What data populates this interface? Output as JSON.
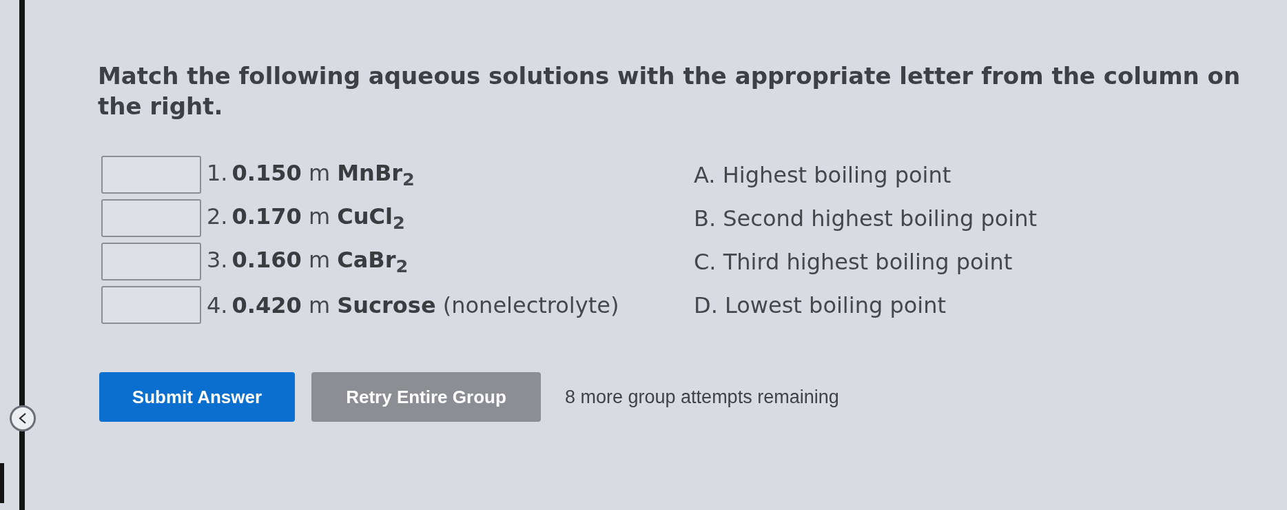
{
  "question": "Match the following aqueous solutions with the appropriate letter from the column on the right.",
  "items": [
    {
      "number": "1.",
      "solution": "**0.150** m **MnBr**$_{2}$"
    },
    {
      "number": "2.",
      "solution": "**0.170** m **CuCl**$_{2}$"
    },
    {
      "number": "3.",
      "solution": "**0.160** m **CaBr**$_{2}$"
    },
    {
      "number": "4.",
      "solution": "**0.420** m **Sucrose** (nonelectrolyte)"
    }
  ],
  "choices": [
    "A. Highest boiling point",
    "B. Second highest boiling point",
    "C. Third highest boiling point",
    "D. Lowest boiling point"
  ],
  "buttons": [
    {
      "label": "Submit Answer",
      "kind": "primary"
    },
    {
      "label": "Retry Entire Group",
      "kind": "secondary"
    }
  ],
  "attempts": "8 more group attempts remaining"
}
